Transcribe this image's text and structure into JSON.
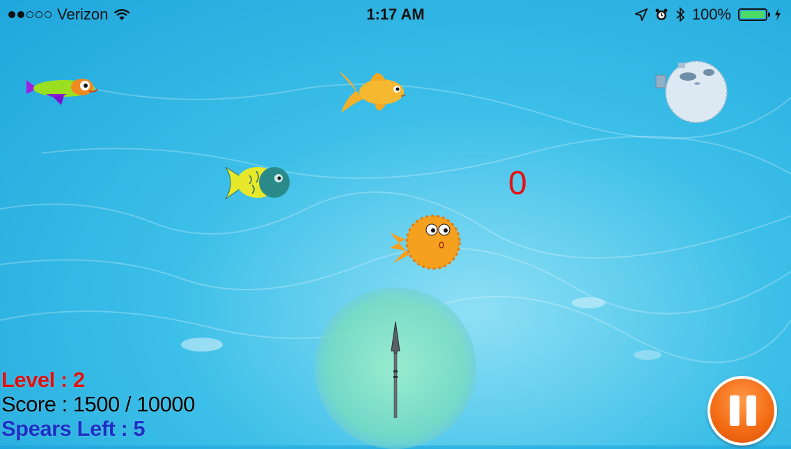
{
  "status_bar": {
    "carrier": "Verizon",
    "time": "1:17 AM",
    "battery_percent": "100%",
    "signal_strength": 2,
    "signal_max": 5
  },
  "hud": {
    "level_text": "Level : 2",
    "score_text": "Score : 1500 / 10000",
    "spears_text": "Spears Left : 5",
    "level_color": "#e01010",
    "score_color": "#000000",
    "spears_color": "#1d2fc4"
  },
  "popup_score": "0",
  "popup_color": "#e81010",
  "colors": {
    "pause": "#f26a12",
    "water": "#3cbfe8"
  },
  "icons": {
    "fish": [
      "rainbow-fish-icon",
      "goldfish-icon",
      "pufferfish-blue-icon",
      "yellow-fish-icon",
      "pufferfish-orange-icon"
    ],
    "spear": "spear-icon",
    "pause": "pause-icon"
  }
}
